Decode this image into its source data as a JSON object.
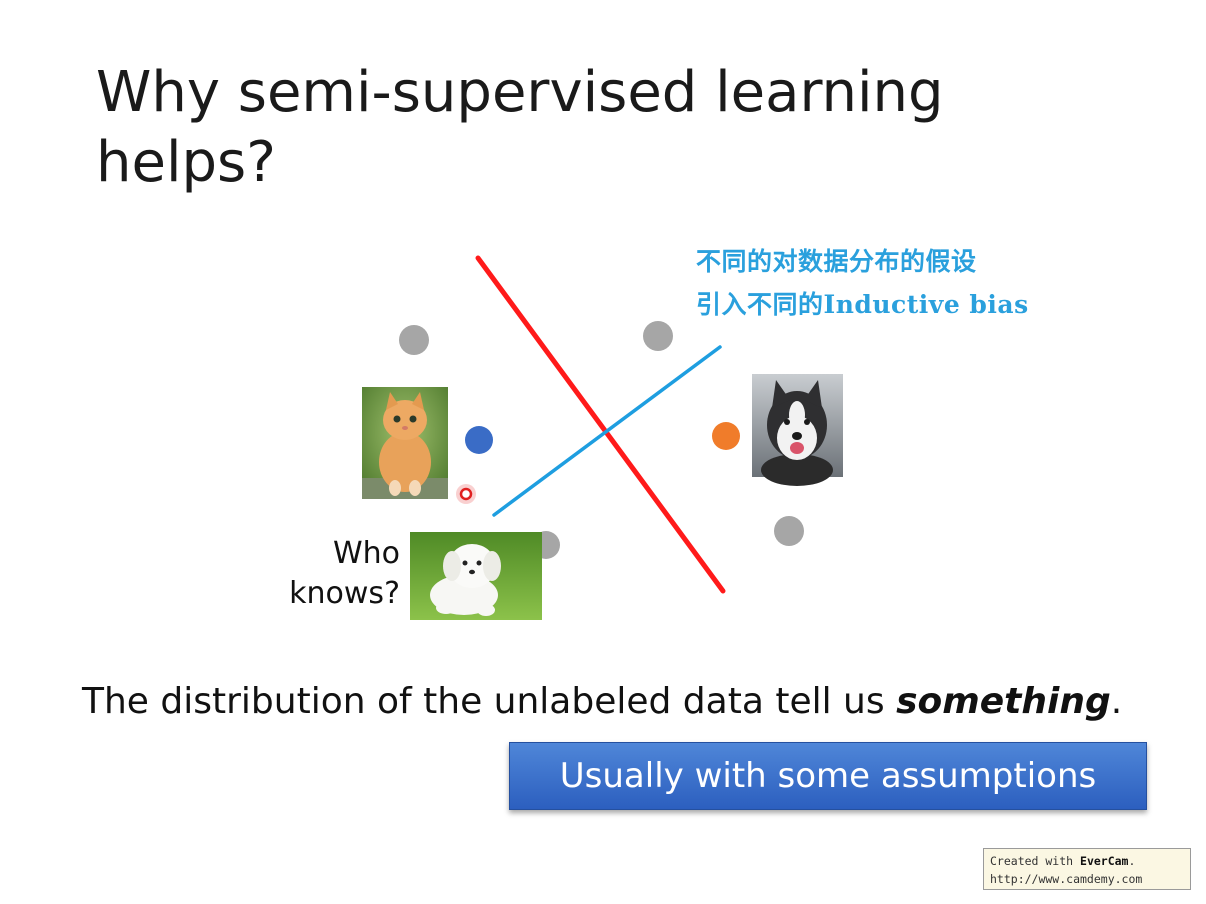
{
  "slide": {
    "title": "Why semi-supervised learning helps?",
    "annotation": {
      "line1": "不同的对数据分布的假设",
      "line2": "引入不同的Inductive bias"
    },
    "who_knows": "Who knows?",
    "statement_prefix": "The distribution of the unlabeled data tell us ",
    "statement_emphasis": "something",
    "statement_suffix": ".",
    "assumption_button": "Usually with some assumptions",
    "watermark": {
      "created_prefix": "Created with ",
      "brand": "EverCam",
      "created_suffix": ".",
      "url": "http://www.camdemy.com"
    }
  },
  "colors": {
    "unlabeled_point": "#a6a6a6",
    "class_cat_point": "#3a6cc6",
    "class_dog_point": "#f07c2a",
    "boundary_line": "#ff1a1a",
    "annotation_line": "#1e9ee0",
    "annotation_text": "#2aa0dd",
    "button_fill": "#3e73cc"
  },
  "icons": {
    "cat_image": "cat-photo",
    "husky_image": "husky-photo",
    "puppy_image": "white-puppy-photo",
    "cursor_marker": "pointer-dot-icon"
  }
}
